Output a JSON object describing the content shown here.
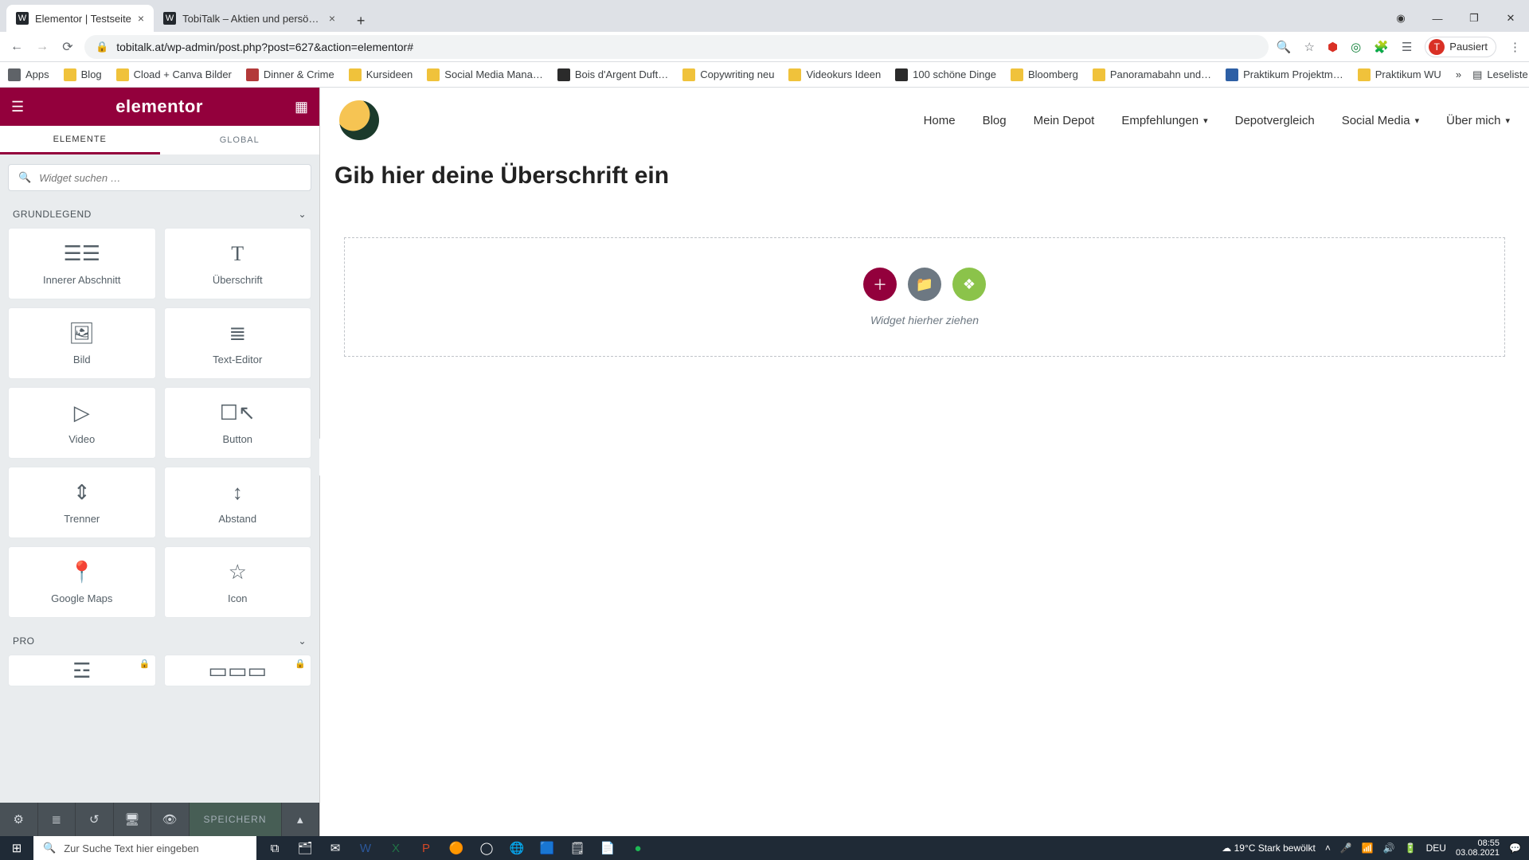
{
  "browser": {
    "tabs": [
      {
        "title": "Elementor | Testseite",
        "active": true
      },
      {
        "title": "TobiTalk – Aktien und persönlich…",
        "active": false
      }
    ],
    "url": "tobitalk.at/wp-admin/post.php?post=627&action=elementor#",
    "pausedLabel": "Pausiert",
    "pausedInitial": "T",
    "bookmarks": {
      "apps": "Apps",
      "items": [
        "Blog",
        "Cload + Canva Bilder",
        "Dinner & Crime",
        "Kursideen",
        "Social Media Mana…",
        "Bois d'Argent Duft…",
        "Copywriting neu",
        "Videokurs Ideen",
        "100 schöne Dinge",
        "Bloomberg",
        "Panoramabahn und…",
        "Praktikum Projektm…",
        "Praktikum WU"
      ],
      "overflow": "»",
      "readingList": "Leseliste"
    }
  },
  "panel": {
    "logo": "elementor",
    "tabs": {
      "elements": "ELEMENTE",
      "global": "GLOBAL"
    },
    "searchPlaceholder": "Widget suchen …",
    "categories": {
      "basic": "GRUNDLEGEND",
      "pro": "PRO"
    },
    "widgets": {
      "innerSection": "Innerer Abschnitt",
      "heading": "Überschrift",
      "image": "Bild",
      "textEditor": "Text-Editor",
      "video": "Video",
      "button": "Button",
      "divider": "Trenner",
      "spacer": "Abstand",
      "maps": "Google Maps",
      "icon": "Icon"
    },
    "footer": {
      "save": "SPEICHERN"
    }
  },
  "canvas": {
    "nav": {
      "home": "Home",
      "blog": "Blog",
      "depot": "Mein Depot",
      "empf": "Empfehlungen",
      "vergleich": "Depotvergleich",
      "social": "Social Media",
      "about": "Über mich"
    },
    "headingPlaceholder": "Gib hier deine Überschrift ein",
    "dropText": "Widget hierher ziehen"
  },
  "taskbar": {
    "searchPlaceholder": "Zur Suche Text hier eingeben",
    "weather": "19°C  Stark bewölkt",
    "lang": "DEU",
    "time": "08:55",
    "date": "03.08.2021"
  }
}
